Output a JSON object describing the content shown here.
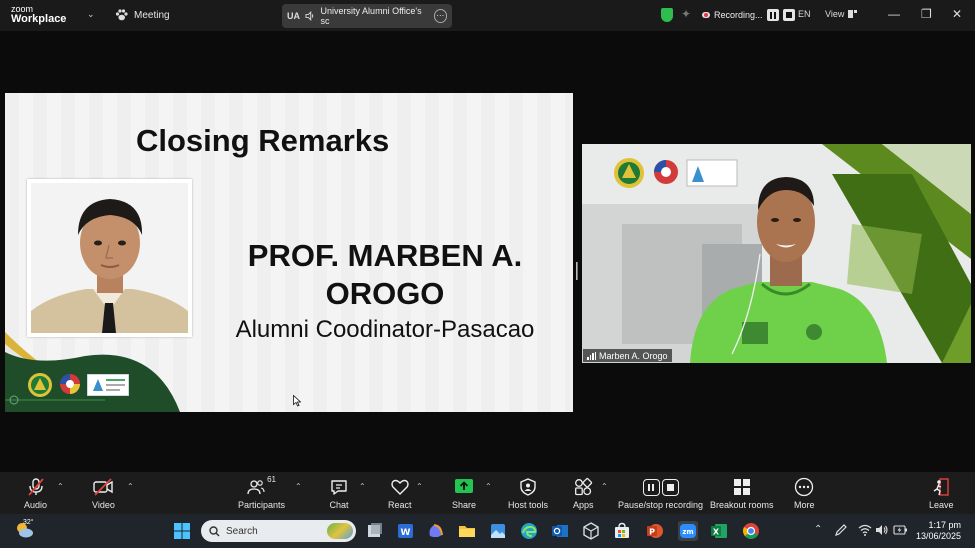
{
  "titlebar": {
    "logo_line1": "zoom",
    "logo_line2": "Workplace",
    "meeting_label": "Meeting",
    "share_initials": "UA",
    "share_title": "University Alumni Office's sc",
    "recording_label": "Recording...",
    "language": "EN",
    "view_label": "View"
  },
  "slide": {
    "title": "Closing Remarks",
    "speaker_name_line1": "PROF. MARBEN A.",
    "speaker_name_line2": "OROGO",
    "speaker_role": "Alumni Coodinator-Pasacao"
  },
  "video": {
    "participant_name": "Marben A. Orogo"
  },
  "toolbar": {
    "audio": "Audio",
    "video": "Video",
    "participants": "Participants",
    "participants_count": "61",
    "chat": "Chat",
    "react": "React",
    "share": "Share",
    "host_tools": "Host tools",
    "apps": "Apps",
    "pause_stop_recording": "Pause/stop recording",
    "breakout_rooms": "Breakout rooms",
    "more": "More",
    "leave": "Leave"
  },
  "taskbar": {
    "temperature": "32°",
    "search_placeholder": "Search",
    "time": "1:17 pm",
    "date": "13/06/2025"
  },
  "colors": {
    "accent_green": "#23c552",
    "slide_dark_green": "#1f4d2a",
    "leave_red": "#e0413b"
  }
}
